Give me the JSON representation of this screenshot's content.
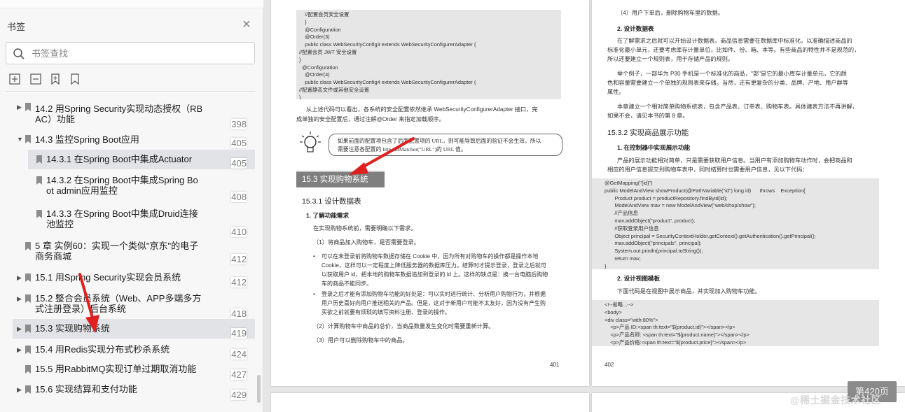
{
  "sidebar": {
    "title": "书签",
    "search_placeholder": "书签查找",
    "tools": [
      "expand-all-icon",
      "collapse-all-icon",
      "add-bookmark-icon",
      "bookmark-flag-icon"
    ],
    "items": [
      {
        "title": "14.2 用Spring Security实现动态授权（RB",
        "title2": "AC）功能",
        "page": "398",
        "caret": "right",
        "level": 1
      },
      {
        "title": "14.3 监控Spring Boot应用",
        "title2": "",
        "page": "405",
        "caret": "down",
        "level": 1
      },
      {
        "title": "14.3.1 在Spring Boot中集成Actuator",
        "title2": "",
        "page": "405",
        "caret": "",
        "level": 2
      },
      {
        "title": "14.3.2 在Spring Boot中集成Spring Bo",
        "title2": "ot admin应用监控",
        "page": "408",
        "caret": "",
        "level": 2
      },
      {
        "title": "14.3.3 在Spring Boot中集成Druid连接",
        "title2": "池监控",
        "page": "410",
        "caret": "",
        "level": 2
      },
      {
        "title": "5 章 实例60：实现一个类似\"京东\"的电子",
        "title2": "商务商城",
        "page": "412",
        "caret": "down",
        "level": 0
      },
      {
        "title": "15.1 用Spring Security实现会员系统",
        "title2": "",
        "page": "412",
        "caret": "right",
        "level": 1
      },
      {
        "title": "15.2 整合会员系统（Web、APP多端多方",
        "title2": "式注册登录）后台系统",
        "page": "418",
        "caret": "right",
        "level": 1
      },
      {
        "title": "15.3 实现购物系统",
        "title2": "",
        "page": "419",
        "caret": "right",
        "level": 1
      },
      {
        "title": "15.4 用Redis实现分布式秒杀系统",
        "title2": "",
        "page": "424",
        "caret": "right",
        "level": 1
      },
      {
        "title": "15.5 用RabbitMQ实现订单过期取消功能",
        "title2": "",
        "page": "427",
        "caret": "",
        "level": 1
      },
      {
        "title": "15.6 实现结算和支付功能",
        "title2": "",
        "page": "429",
        "caret": "right",
        "level": 1
      }
    ]
  },
  "doc": {
    "left": {
      "code1": "    //配置会员安全设置\n    }\n    @Configuration\n    @Order(3)\n    public class WebSecurityConfig3 extends WebSecurityConfigurerAdapter {\n//配置会员 JWT 安全设置\n}\n  @Configuration\n    @Order(4)\n    public class WebSecurityConfig4 extends WebSecurityConfigurerAdapter {\n//配置静态文件或其他安全设置\n}",
      "para1a": "从上述代码可以看出，各系统的安全配置依然继承 WebSecurityConfigurerAdapter 接口，完",
      "para1b": "成单独的安全配置后，通过注解@Order 来指定加载顺序。",
      "tip1": "如果前面的配置项包含了后面配置项的 URL，则可能导致后面的验证不会生效，所以",
      "tip2": "需要注意各配置的 http.antMatcher(\"URL\")的 URL 值。",
      "section": "15.3   实现购物系统",
      "sub1": "15.3.1    设计数据表",
      "h1": "1. 了解功能需求",
      "p2": "在实现购物系统前，需要明确以下需求。",
      "p3": "（1）将商品加入购物车，是否需要登录。",
      "b1a": "可以在未登录前将购物车数据存储在 Cookie 中，因为所有对购物车的操作都是操作本地",
      "b1b": "Cookie，这样可以一定程度上降低服务器的数据库压力。结算时才提示登录，登录之后就可",
      "b1c": "以获取用户 id，把本地的购物车数据追加到登录的 id 上。这样的缺点是：换一台电脑后购物",
      "b1d": "车的商品不能同步。",
      "b2a": "登录之后才能有添加购物车功能的好处是：可以实时进行统计、分析用户购物行为，并根据",
      "b2b": "用户历史喜好向用户推送相关的产品。但是，这对于新用户可能不太友好，因为没有产生购",
      "b2c": "买欲之前就要有烦琐的填写资料注册、登录的操作。",
      "p4": "（2）计算购物车中商品的总价，当商品数量发生变化时需要重新计算。",
      "p5": "（3）用户可以删除购物车中的商品。",
      "pnum": "401"
    },
    "right": {
      "p1": "（4）用户下单后，删除购物车里的数据。",
      "h1": "2. 设计数据表",
      "p2a": "在了解需求之后就可以开始设计数据表。商品信息需要在数据库中标准化，以准确描述商品的",
      "p2b": "标准化最小单元，还要考虑库存计量单位，比如件、份、箱、本等。有些商品的特性并不是规范的，",
      "p2c": "所以还要建立一个规则表，用于存储产品的规则。",
      "p3a": "举个例子，一部华为 P30 手机是一个标准化的商品，\"部\"是它的最小库存计量单元，它的颜",
      "p3b": "色和容量需要建立一个单独的规则表来存储。当然，还有更复杂的分类、品牌、产地、用户群等",
      "p3c": "属性。",
      "p4a": "本章建立一个相对简单购物系统表，包含产品表、订单表、购物车表。具体建表方法不再讲解，",
      "p4b": "如果不会，请见本书的第 8 章。",
      "sub1": "15.3.2    实现商品展示功能",
      "h2": "1. 在控制器中实现展示功能",
      "p5a": "产品的展示功能相对简单，只是需要获取用户信息。当用户有添加购物车动作时，会把商品和",
      "p5b": "相应的用户信息提交到购物车表中，同时结算时也需要用户信息，见以下代码：",
      "code1": "@GetMapping(\"{id}\")\npublic ModelAndView showProduct(@PathVariable(\"id\") long id)      throws    Exception{\n       Product product = productRepository.findByid(id);\n       ModelAndView mav = new ModelAndView(\"web/shop/show\");\n       //产品信息\n       mav.addObject(\"product\", product);\n       //获取登录用户信息\n       Object principal = SecurityContextHolder.getContext().getAuthentication().getPrincipal();\n       mav.addObject(\"principals\", principal);\n       System.out.println(principal.toString());\n       return mav;\n}",
      "h3": "2. 设计视图模板",
      "p6": "下面代码是在视图中展示商品，并实现加入购物车功能。",
      "code2": "<!--省略...-->\n<body>\n<div class=\"with:80%\">\n    <p>产品 ID:<span th:text=\"${product.id}\"></span></p>\n    <p>产品名称: <span th:text=\"${product.name}\"></span></p>\n    <p>产品价格:<span th:text=\"${product.price}\"></span></p>",
      "pnum": "402"
    }
  },
  "page_indicator": "第420页",
  "watermark": "@稀土掘金技术社区",
  "colors": {
    "arrow": "#e02020",
    "selected": "#e1e3e6",
    "section_bar": "#7f7f7f"
  }
}
